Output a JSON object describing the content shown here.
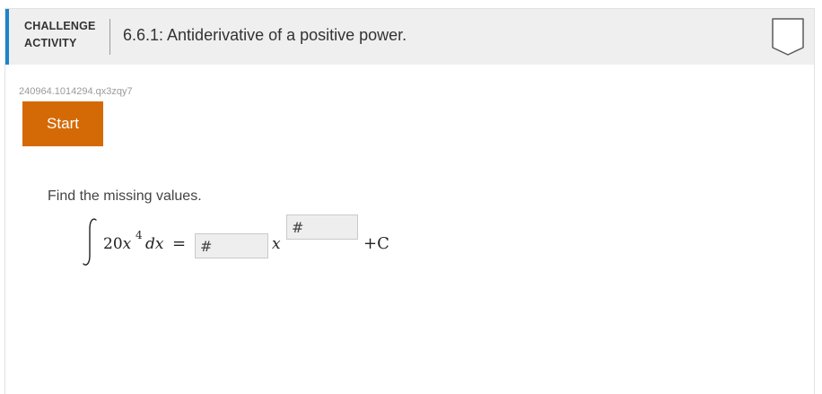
{
  "header": {
    "activity_type_line1": "CHALLENGE",
    "activity_type_line2": "ACTIVITY",
    "title": "6.6.1: Antiderivative of a positive power.",
    "completion_icon": "badge-outline-icon",
    "accent_color": "#1a86c8"
  },
  "activity_id": "240964.1014294.qx3zqy7",
  "start_button": {
    "label": "Start",
    "color": "#d46a06"
  },
  "problem": {
    "instructions": "Find the missing values.",
    "integral_icon": "integral-sign-icon",
    "integrand_coefficient": "20",
    "integrand_variable": "x",
    "integrand_exponent": "4",
    "differential": "dx",
    "equals": "=",
    "coefficient_placeholder": "#",
    "result_variable": "x",
    "exponent_placeholder": "#",
    "constant": "+C"
  }
}
